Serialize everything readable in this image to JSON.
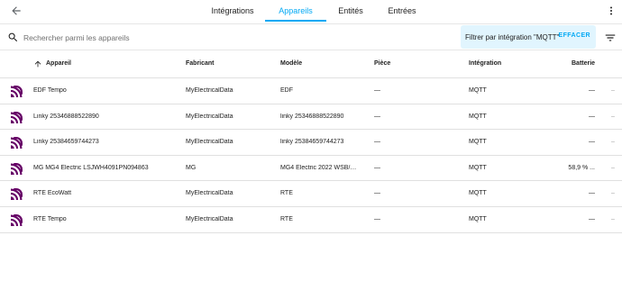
{
  "toolbar": {
    "back_icon": "arrow-left-icon",
    "tabs": [
      {
        "label": "Intégrations",
        "active": false
      },
      {
        "label": "Appareils",
        "active": true
      },
      {
        "label": "Entités",
        "active": false
      },
      {
        "label": "Entrées",
        "active": false
      }
    ],
    "more_icon": "dots-vertical-icon"
  },
  "search": {
    "placeholder": "Rechercher parmi les appareils",
    "value": "",
    "filter_label": "Filtrer par intégration \"MQTT\"",
    "clear_label": "EFFACER",
    "filter_icon": "filter-list-icon"
  },
  "table": {
    "columns": [
      "Appareil",
      "Fabricant",
      "Modèle",
      "Pièce",
      "Intégration",
      "Batterie"
    ],
    "sort_icon": "arrow-up-icon",
    "device_icon": "mqtt-icon",
    "rows": [
      {
        "name": "EDF Tempo",
        "manufacturer": "MyElectricalData",
        "model": "EDF",
        "area": "—",
        "integration": "MQTT",
        "battery": "—",
        "extra": "–"
      },
      {
        "name": "Linky 25346888522890",
        "manufacturer": "MyElectricalData",
        "model": "linky 25346888522890",
        "area": "—",
        "integration": "MQTT",
        "battery": "—",
        "extra": "–"
      },
      {
        "name": "Linky 25384659744273",
        "manufacturer": "MyElectricalData",
        "model": "linky 25384659744273",
        "area": "—",
        "integration": "MQTT",
        "battery": "—",
        "extra": "–"
      },
      {
        "name": "MG MG4 Electric LSJWH4091PN094863",
        "manufacturer": "MG",
        "model": "MG4 Electric 2022 WSB/P...",
        "area": "—",
        "integration": "MQTT",
        "battery": "58,9 % ...",
        "extra": "–"
      },
      {
        "name": "RTE EcoWatt",
        "manufacturer": "MyElectricalData",
        "model": "RTE",
        "area": "—",
        "integration": "MQTT",
        "battery": "—",
        "extra": "–"
      },
      {
        "name": "RTE Tempo",
        "manufacturer": "MyElectricalData",
        "model": "RTE",
        "area": "—",
        "integration": "MQTT",
        "battery": "—",
        "extra": "–"
      }
    ]
  },
  "colors": {
    "accent": "#03a9f4",
    "chip_bg": "#e1f5fe",
    "mqtt_icon": "#660066"
  }
}
